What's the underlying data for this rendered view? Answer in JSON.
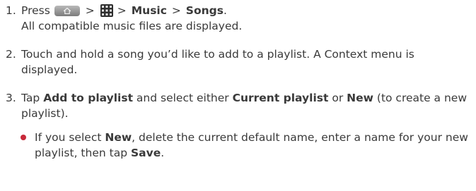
{
  "icons": {
    "home_key": "home-key-icon",
    "apps": "applications-grid-icon",
    "bullet": "bullet-dot-icon"
  },
  "colors": {
    "bullet": "#c8293a",
    "text": "#3a3a3a"
  },
  "steps": [
    {
      "num": "1.",
      "press": "Press",
      "gt1": ">",
      "gt2": ">",
      "music": "Music",
      "gt3": ">",
      "songs": "Songs",
      "period": ".",
      "line2": "All compatible music files are displayed."
    },
    {
      "num": "2.",
      "text": "Touch and hold a song you’d like to add to a playlist. A Context menu is displayed."
    },
    {
      "num": "3.",
      "tap": "Tap",
      "add": "Add to playlist",
      "mid": "and select either",
      "current": "Current playlist",
      "or": "or",
      "new": "New",
      "tail": "(to create a new playlist).",
      "bullet": {
        "pre": "If you select",
        "new": "New",
        "mid": ", delete the current default name, enter a name for your new playlist, then tap",
        "save": "Save",
        "end": "."
      }
    }
  ]
}
